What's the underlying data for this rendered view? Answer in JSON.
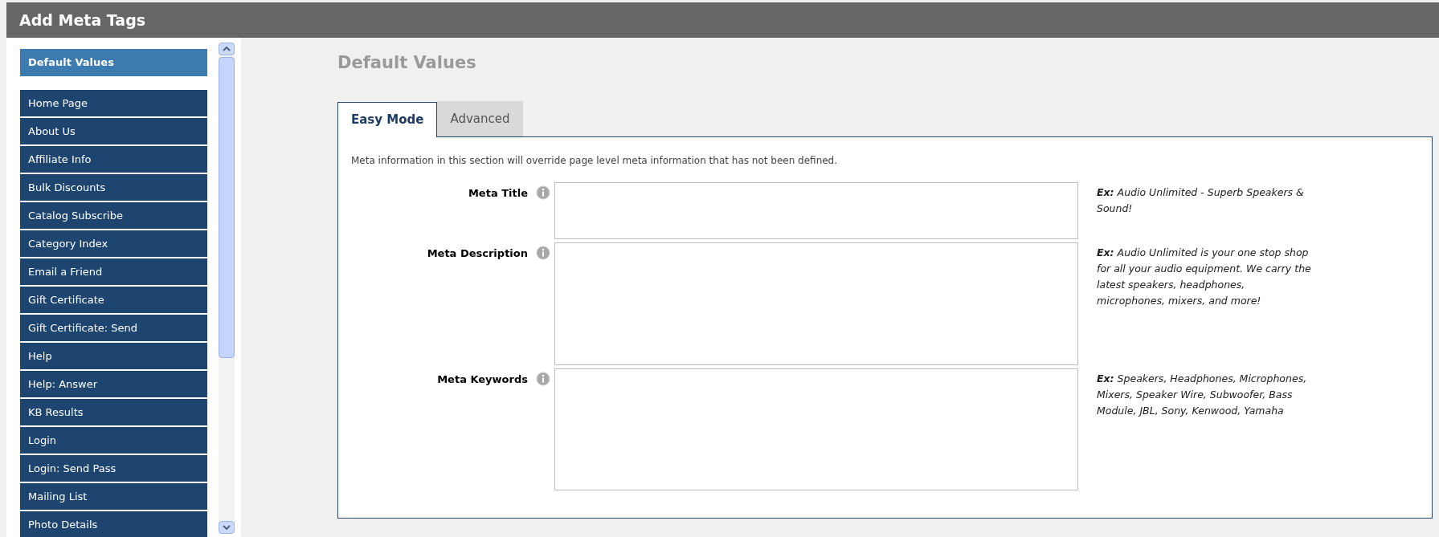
{
  "window": {
    "title": "Add Meta Tags"
  },
  "sidebar": {
    "items": [
      {
        "label": "Default Values",
        "selected": true
      },
      {
        "label": "Home Page",
        "selected": false
      },
      {
        "label": "About Us",
        "selected": false
      },
      {
        "label": "Affiliate Info",
        "selected": false
      },
      {
        "label": "Bulk Discounts",
        "selected": false
      },
      {
        "label": "Catalog Subscribe",
        "selected": false
      },
      {
        "label": "Category Index",
        "selected": false
      },
      {
        "label": "Email a Friend",
        "selected": false
      },
      {
        "label": "Gift Certificate",
        "selected": false
      },
      {
        "label": "Gift Certificate: Send",
        "selected": false
      },
      {
        "label": "Help",
        "selected": false
      },
      {
        "label": "Help: Answer",
        "selected": false
      },
      {
        "label": "KB Results",
        "selected": false
      },
      {
        "label": "Login",
        "selected": false
      },
      {
        "label": "Login: Send Pass",
        "selected": false
      },
      {
        "label": "Mailing List",
        "selected": false
      },
      {
        "label": "Photo Details",
        "selected": false
      }
    ]
  },
  "heading": "Default Values",
  "tabs": [
    {
      "label": "Easy Mode",
      "selected": true
    },
    {
      "label": "Advanced",
      "selected": false
    }
  ],
  "description": "Meta information in this section will override page level meta information that has not been defined.",
  "fields": [
    {
      "label": "Meta Title",
      "example": "**Ex:** Audio Unlimited - Superb Speakers & Sound!"
    },
    {
      "label": "Meta Description",
      "example": "**Ex:** Audio Unlimited is your one stop shop for all your audio equipment. We carry the latest speakers, headphones, microphones, mixers, and more!"
    },
    {
      "label": "Meta Keywords",
      "example": "**Ex:** Speakers, Headphones, Microphones, Mixers, Speaker Wire, Subwoofer, Bass Module, JBL, Sony, Kenwood, Yamaha"
    }
  ]
}
